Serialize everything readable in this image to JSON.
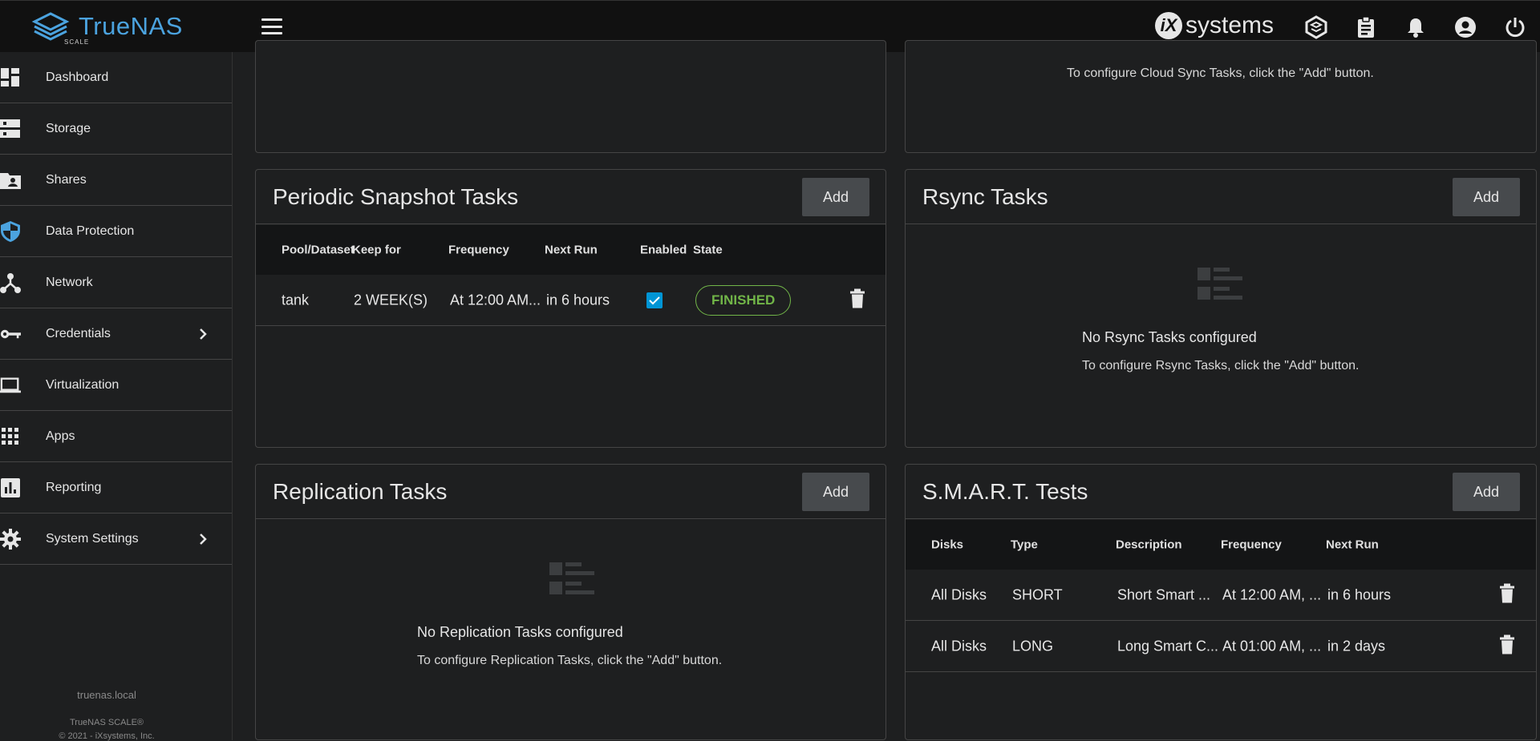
{
  "header": {
    "brand": "TrueNAS",
    "brand_sub": "SCALE",
    "vendor": "systems",
    "vendor_mark": "iX",
    "icons": [
      "truecommand-icon",
      "task-manager-icon",
      "notifications-icon",
      "account-icon",
      "power-icon"
    ]
  },
  "sidebar": {
    "items": [
      {
        "label": "Dashboard",
        "icon": "dashboard-icon"
      },
      {
        "label": "Storage",
        "icon": "storage-icon"
      },
      {
        "label": "Shares",
        "icon": "shares-icon"
      },
      {
        "label": "Data Protection",
        "icon": "shield-icon"
      },
      {
        "label": "Network",
        "icon": "network-icon"
      },
      {
        "label": "Credentials",
        "icon": "key-icon"
      },
      {
        "label": "Virtualization",
        "icon": "laptop-icon"
      },
      {
        "label": "Apps",
        "icon": "apps-icon"
      },
      {
        "label": "Reporting",
        "icon": "chart-icon"
      },
      {
        "label": "System Settings",
        "icon": "gear-icon"
      }
    ],
    "hostname": "truenas.local",
    "footer_product": "TrueNAS SCALE®",
    "footer_copyright": "© 2021 - iXsystems, Inc."
  },
  "cloud_sync": {
    "empty_text": "To configure Cloud Sync Tasks, click the \"Add\" button."
  },
  "snapshot": {
    "title": "Periodic Snapshot Tasks",
    "add_label": "Add",
    "columns": [
      "Pool/Dataset",
      "Keep for",
      "Frequency",
      "Next Run",
      "Enabled",
      "State"
    ],
    "rows": [
      {
        "dataset": "tank",
        "keep": "2 WEEK(S)",
        "frequency": "At 12:00 AM...",
        "next_run": "in 6 hours",
        "enabled": true,
        "state": "FINISHED"
      }
    ]
  },
  "rsync": {
    "title": "Rsync Tasks",
    "add_label": "Add",
    "empty_title": "No Rsync Tasks configured",
    "empty_text": "To configure Rsync Tasks, click the \"Add\" button."
  },
  "replication": {
    "title": "Replication Tasks",
    "add_label": "Add",
    "empty_title": "No Replication Tasks configured",
    "empty_text": "To configure Replication Tasks, click the \"Add\" button."
  },
  "smart": {
    "title": "S.M.A.R.T. Tests",
    "add_label": "Add",
    "columns": [
      "Disks",
      "Type",
      "Description",
      "Frequency",
      "Next Run"
    ],
    "rows": [
      {
        "disks": "All Disks",
        "type": "SHORT",
        "description": "Short Smart ...",
        "frequency": "At 12:00 AM, ...",
        "next_run": "in 6 hours"
      },
      {
        "disks": "All Disks",
        "type": "LONG",
        "description": "Long Smart C...",
        "frequency": "At 01:00 AM, ...",
        "next_run": "in 2 days"
      }
    ]
  },
  "colors": {
    "accent": "#4ba3df",
    "status_ok": "#71b548",
    "checkbox": "#0095d5",
    "background": "#1e1f20",
    "topbar": "#111111"
  }
}
